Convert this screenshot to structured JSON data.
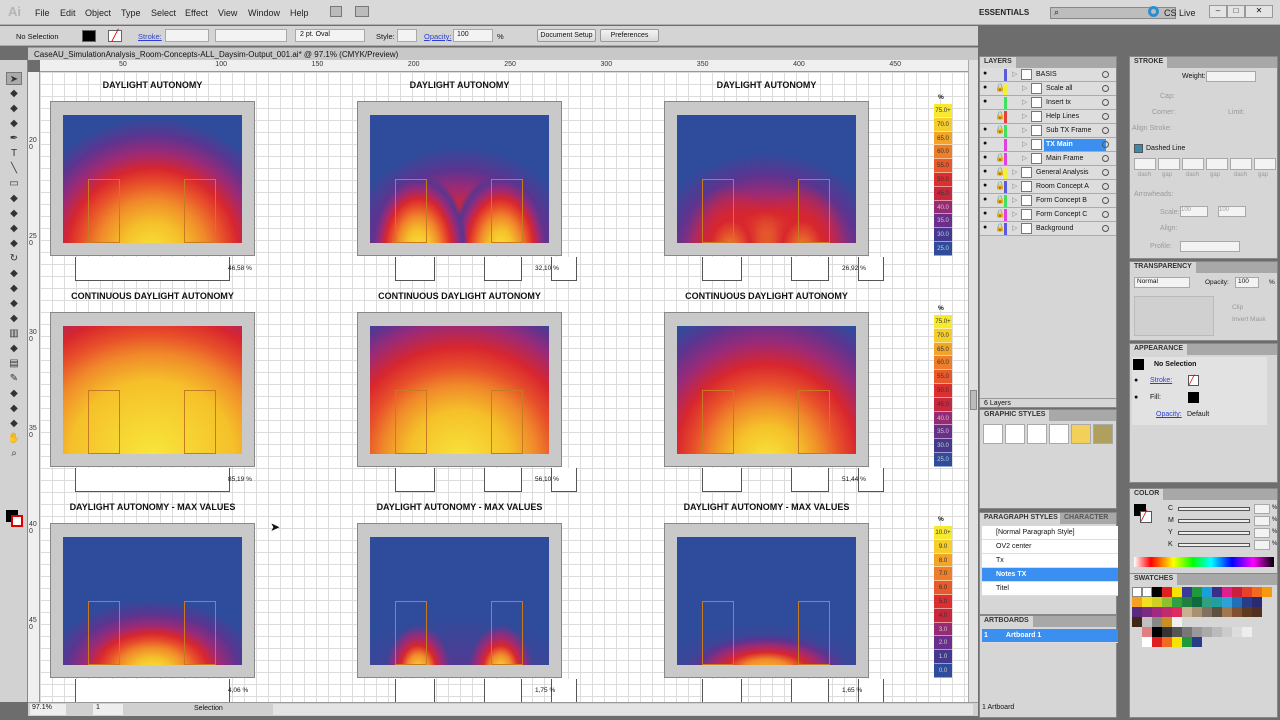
{
  "app": {
    "logo": "Ai",
    "menu": [
      "File",
      "Edit",
      "Object",
      "Type",
      "Select",
      "Effect",
      "View",
      "Window",
      "Help"
    ],
    "workspace": "ESSENTIALS",
    "cs_live": "CS Live"
  },
  "control": {
    "selection": "No Selection",
    "stroke_label": "Stroke:",
    "brush": "2 pt. Oval",
    "style_label": "Style:",
    "opacity_label": "Opacity:",
    "opacity": "100",
    "pct": "%",
    "doc_setup": "Document Setup",
    "preferences": "Preferences"
  },
  "document": {
    "tab": "CaseAU_SimulationAnalysis_Room-Concepts-ALL_Daysim-Output_001.ai* @ 97.1% (CMYK/Preview)"
  },
  "ruler": {
    "h": [
      "50",
      "100",
      "150",
      "200",
      "250",
      "300",
      "350",
      "400",
      "450"
    ],
    "v": [
      "200",
      "250",
      "300",
      "350",
      "400",
      "450"
    ]
  },
  "tools": [
    "selection",
    "direct-selection",
    "magic-wand",
    "lasso",
    "pen",
    "type",
    "line",
    "rectangle",
    "paintbrush",
    "pencil",
    "blob-brush",
    "eraser",
    "rotate",
    "scale",
    "warp",
    "free-transform",
    "symbol-sprayer",
    "graph",
    "mesh",
    "gradient",
    "eyedropper",
    "blend",
    "live-paint",
    "slice",
    "hand",
    "zoom"
  ],
  "canvas": {
    "rows": [
      {
        "title": "DAYLIGHT AUTONOMY",
        "percents": [
          "46,58 %",
          "32,10 %",
          "26,92 %"
        ]
      },
      {
        "title": "CONTINUOUS DAYLIGHT AUTONOMY",
        "percents": [
          "85,19 %",
          "56,10 %",
          "51,44 %"
        ]
      },
      {
        "title": "DAYLIGHT AUTONOMY - MAX VALUES",
        "percents": [
          "4,06 %",
          "1,75 %",
          "1,65 %"
        ]
      }
    ],
    "legends": [
      {
        "unit": "%",
        "labels": [
          "75.0+",
          "70.0",
          "65.0",
          "60.0",
          "55.0",
          "50.0",
          "45.0",
          "40.0",
          "35.0",
          "30.0",
          "25.0"
        ]
      },
      {
        "unit": "%",
        "labels": [
          "75.0+",
          "70.0",
          "65.0",
          "60.0",
          "55.0",
          "50.0",
          "45.0",
          "40.0",
          "35.0",
          "30.0",
          "25.0"
        ]
      },
      {
        "unit": "%",
        "labels": [
          "10.0+",
          "9.0",
          "8.0",
          "7.0",
          "6.0",
          "5.0",
          "4.0",
          "3.0",
          "2.0",
          "1.0",
          "0.0"
        ]
      }
    ],
    "legend_colors": [
      "#f7e831",
      "#f5cd2c",
      "#f3a52b",
      "#ee7e2a",
      "#e85a2b",
      "#dc3030",
      "#c8283e",
      "#962a74",
      "#6a2f8c",
      "#44398f",
      "#2f4c9c"
    ]
  },
  "status": {
    "zoom": "97.1%",
    "artboard": "1",
    "tool": "Selection"
  },
  "layers": {
    "title": "LAYERS",
    "footer": "6 Layers",
    "items": [
      {
        "name": "BASIS",
        "lock": false,
        "color": "#5a5ae0",
        "indent": 0,
        "eye": true
      },
      {
        "name": "Scale all",
        "lock": true,
        "color": "#f0f040",
        "indent": 1,
        "eye": true
      },
      {
        "name": "Insert tx",
        "lock": false,
        "color": "#40e060",
        "indent": 1,
        "eye": true
      },
      {
        "name": "Help Lines",
        "lock": true,
        "color": "#e04040",
        "indent": 1,
        "eye": false
      },
      {
        "name": "Sub TX Frame",
        "lock": true,
        "color": "#40e060",
        "indent": 1,
        "eye": true
      },
      {
        "name": "TX Main",
        "lock": false,
        "color": "#e040e0",
        "indent": 1,
        "eye": true,
        "selected": true
      },
      {
        "name": "Main Frame",
        "lock": true,
        "color": "#e040e0",
        "indent": 1,
        "eye": true
      },
      {
        "name": "General Analysis",
        "lock": true,
        "color": "#f0f040",
        "indent": 0,
        "eye": true
      },
      {
        "name": "Room Concept A",
        "lock": true,
        "color": "#5a5ae0",
        "indent": 0,
        "eye": true
      },
      {
        "name": "Form Concept B",
        "lock": true,
        "color": "#40e060",
        "indent": 0,
        "eye": true
      },
      {
        "name": "Form Concept C",
        "lock": true,
        "color": "#e040e0",
        "indent": 0,
        "eye": true
      },
      {
        "name": "Background",
        "lock": true,
        "color": "#5a5ae0",
        "indent": 0,
        "eye": true
      }
    ]
  },
  "stroke": {
    "title": "STROKE",
    "weight_label": "Weight:",
    "cap": "Cap:",
    "corner": "Corner:",
    "limit": "Limit:",
    "align": "Align Stroke:",
    "dashed": "Dashed Line",
    "dash_labels": [
      "dash",
      "gap",
      "dash",
      "gap",
      "dash",
      "gap"
    ],
    "arrowheads": "Arrowheads:",
    "scale": "Scale:",
    "scale1": "100",
    "scale2": "100",
    "align2": "Align:",
    "profile": "Profile:"
  },
  "transparency": {
    "title": "TRANSPARENCY",
    "mode": "Normal",
    "opacity_label": "Opacity:",
    "opacity": "100",
    "pct": "%",
    "clip": "Clip",
    "invert": "Invert Mask"
  },
  "appearance": {
    "title": "APPEARANCE",
    "selection": "No Selection",
    "stroke": "Stroke:",
    "fill": "Fill:",
    "opacity": "Opacity:",
    "opacity_value": "Default"
  },
  "graphic_styles": {
    "title": "GRAPHIC STYLES"
  },
  "paragraph": {
    "title": "PARAGRAPH STYLES",
    "tab2": "CHARACTER",
    "items": [
      "[Normal Paragraph Style]",
      "OV2 center",
      "Tx",
      "Notes TX",
      "Titel"
    ],
    "selected": 3
  },
  "artboards": {
    "title": "ARTBOARDS",
    "items": [
      {
        "num": "1",
        "name": "Artboard 1"
      }
    ],
    "footer": "1 Artboard"
  },
  "color": {
    "title": "COLOR",
    "channels": [
      "C",
      "M",
      "Y",
      "K"
    ],
    "pct": "%"
  },
  "swatches": {
    "title": "SWATCHES",
    "colors": [
      "#000000",
      "#e02020",
      "#f5e400",
      "#3a3a9a",
      "#1f9a3a",
      "#1aa0d8",
      "#3a2e8a",
      "#e0208a",
      "#c8203a",
      "#e8402a",
      "#f06a20",
      "#f59a10",
      "#f5a020",
      "#f0e020",
      "#d0d020",
      "#90c030",
      "#30a040",
      "#208040",
      "#106a40",
      "#30a080",
      "#20a0a0",
      "#30a0d8",
      "#2070b8",
      "#283c8a",
      "#2a2a70",
      "#5a2a80",
      "#7a2a80",
      "#a02a80",
      "#c02a70",
      "#e02a60",
      "#c8b090",
      "#a89070",
      "#807060",
      "#605040",
      "#a07850",
      "#805030",
      "#603a20",
      "#503020",
      "#402818",
      "#c0c0c0",
      "#888888",
      "#c89020",
      "#f0f0f0",
      "#e08080",
      "#000000",
      "#333333",
      "#555555",
      "#777777",
      "#999999",
      "#aaaaaa",
      "#bbbbbb",
      "#cccccc",
      "#dddddd",
      "#eeeeee",
      "#ffffff",
      "#e02020",
      "#f06a20",
      "#f5e400",
      "#1f9a3a",
      "#283c8a",
      "#6a3a9a"
    ]
  }
}
